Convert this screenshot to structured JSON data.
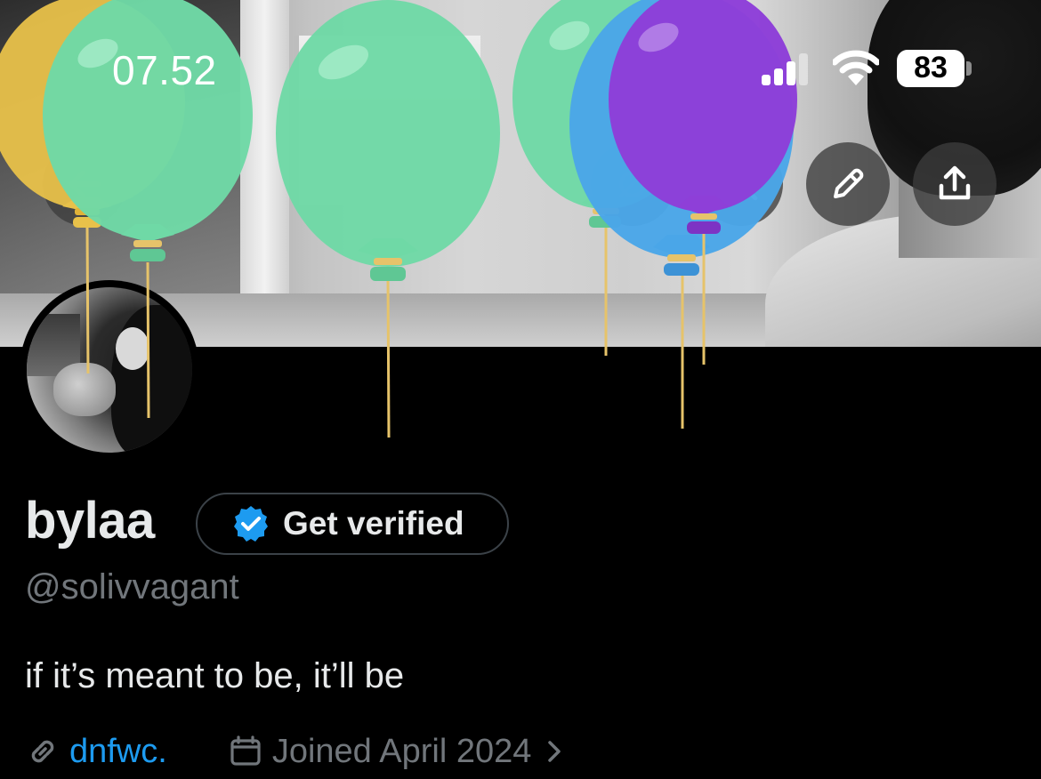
{
  "status_bar": {
    "time": "07.52",
    "battery": "83",
    "icons": [
      "signal-icon",
      "wifi-icon",
      "battery-icon"
    ]
  },
  "header_actions": [
    "back-arrow-icon",
    "grok-icon",
    "search-icon",
    "edit-pencil-icon",
    "share-icon"
  ],
  "profile": {
    "display_name": "bylaa",
    "verify_label": "Get verified",
    "handle": "@solivvagant",
    "bio": "if it’s meant to be, it’ll be",
    "website": "dnfwc.",
    "joined": "Joined April 2024"
  },
  "decorations": {
    "balloon_colors": [
      "#e8c14a",
      "#6fd9a6",
      "#6fd9a6",
      "#6fd9a6",
      "#4aa6e8",
      "#8e3fd8"
    ],
    "accent_blue": "#1d9bf0",
    "muted_gray": "#71767b"
  }
}
